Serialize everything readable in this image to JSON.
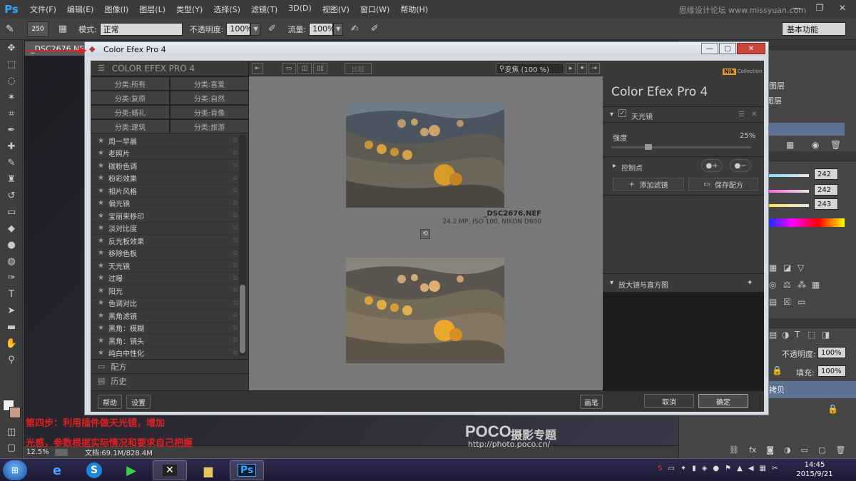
{
  "ps": {
    "logo": "Ps",
    "menu": [
      "文件(F)",
      "编辑(E)",
      "图像(I)",
      "图层(L)",
      "类型(Y)",
      "选择(S)",
      "滤镜(T)",
      "3D(D)",
      "视图(V)",
      "窗口(W)",
      "帮助(H)"
    ],
    "watermark_top": "思缘设计论坛 www.missyuan.com",
    "options": {
      "brush_size": "250",
      "mode_label": "模式:",
      "mode_value": "正常",
      "opacity_label": "不透明度:",
      "opacity_value": "100%",
      "flow_label": "流量:",
      "flow_value": "100%"
    },
    "workspace": "基本功能",
    "doc_tab": "_DSC2676.NEF",
    "status_zoom": "12.5%",
    "status_doc": "文档:69.1M/828.4M"
  },
  "right_panel": {
    "layers_label1": "图层",
    "layers_label2": "图层",
    "rgb_values": [
      "242",
      "242",
      "243"
    ],
    "opacity_label": "不透明度:",
    "opacity_value": "100%",
    "fill_label": "填充:",
    "fill_value": "100%",
    "layer_name": "拷贝"
  },
  "cef": {
    "window_title": "Color Efex Pro 4",
    "left_header": "COLOR EFEX PRO 4",
    "categories": [
      "分类:所有",
      "分类:喜爱",
      "分类:复原",
      "分类:自然",
      "分类:婚礼",
      "分类:肖像",
      "分类:建筑",
      "分类:旅游"
    ],
    "filters": [
      "周一早晨",
      "老照片",
      "碳粉色调",
      "粉彩效果",
      "相片风格",
      "偏光镜",
      "宝丽来移印",
      "淡对比度",
      "反光板效果",
      "移除色板",
      "天光镜",
      "过曝",
      "阳光",
      "色调对比",
      "黑角滤镜",
      "黑角：模糊",
      "黑角：镜头",
      "纯白中性化"
    ],
    "section_recipes": "配方",
    "section_history": "历史",
    "btn_help": "帮助",
    "btn_settings": "设置",
    "btn_compare": "比较",
    "zoom": "变焦 (100 %)",
    "photo_name": "_DSC2676.NEF",
    "photo_info": "24.2 MP, ISO 100, NIKON D600",
    "btn_brush": "画笔",
    "btn_cancel": "取消",
    "btn_ok": "确定",
    "nik_label": "Nik",
    "nik_sub": "Collection",
    "big_title": "Color Efex Pro 4",
    "filter_name": "天光镜",
    "strength_label": "强度",
    "strength_value": "25%",
    "strength_fraction": 0.25,
    "control_points": "控制点",
    "btn_add_filter": "添加滤镜",
    "btn_save_recipe": "保存配方",
    "loupe_title": "放大镜与直方图"
  },
  "annotation": {
    "line1": "第四步：利用插件做天光镜，增加",
    "line2": "光感，参数根据实际情况和要求自己把握"
  },
  "poco": {
    "logo": "POCO",
    "title": "摄影专题",
    "url": "http://photo.poco.cn/"
  },
  "taskbar": {
    "time": "14:45",
    "date": "2015/9/21"
  }
}
